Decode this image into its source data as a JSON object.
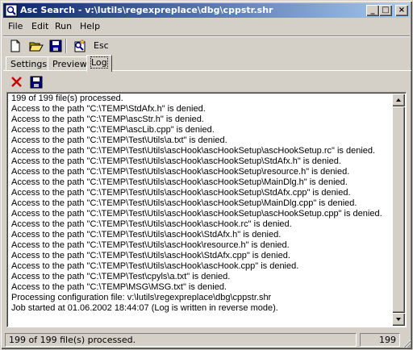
{
  "window": {
    "title": "Asc Search - v:\\lutils\\regexpreplace\\dbg\\cppstr.shr"
  },
  "title_buttons": {
    "minimize": "_",
    "maximize": "□",
    "close": "×"
  },
  "menu": [
    {
      "label": "File"
    },
    {
      "label": "Edit"
    },
    {
      "label": "Run"
    },
    {
      "label": "Help"
    }
  ],
  "toolbar": {
    "icons": [
      "new-file-icon",
      "open-folder-icon",
      "save-icon",
      "search-run-icon"
    ],
    "esc_label": "Esc"
  },
  "tabs": [
    {
      "label": "Settings"
    },
    {
      "label": "Preview"
    },
    {
      "label": "Log",
      "active": true
    }
  ],
  "log_toolbar": {
    "icons": [
      "clear-log-icon",
      "save-log-icon"
    ],
    "clear_color": "#cc0000"
  },
  "log": {
    "lines": [
      "199 of 199 file(s) processed.",
      "Access to the path \"C:\\TEMP\\StdAfx.h\" is denied.",
      "Access to the path \"C:\\TEMP\\ascStr.h\" is denied.",
      "Access to the path \"C:\\TEMP\\ascLib.cpp\" is denied.",
      "Access to the path \"C:\\TEMP\\Test\\Utils\\a.txt\" is denied.",
      "Access to the path \"C:\\TEMP\\Test\\Utils\\ascHook\\ascHookSetup\\ascHookSetup.rc\" is denied.",
      "Access to the path \"C:\\TEMP\\Test\\Utils\\ascHook\\ascHookSetup\\StdAfx.h\" is denied.",
      "Access to the path \"C:\\TEMP\\Test\\Utils\\ascHook\\ascHookSetup\\resource.h\" is denied.",
      "Access to the path \"C:\\TEMP\\Test\\Utils\\ascHook\\ascHookSetup\\MainDlg.h\" is denied.",
      "Access to the path \"C:\\TEMP\\Test\\Utils\\ascHook\\ascHookSetup\\StdAfx.cpp\" is denied.",
      "Access to the path \"C:\\TEMP\\Test\\Utils\\ascHook\\ascHookSetup\\MainDlg.cpp\" is denied.",
      "Access to the path \"C:\\TEMP\\Test\\Utils\\ascHook\\ascHookSetup\\ascHookSetup.cpp\" is denied.",
      "Access to the path \"C:\\TEMP\\Test\\Utils\\ascHook\\ascHook.rc\" is denied.",
      "Access to the path \"C:\\TEMP\\Test\\Utils\\ascHook\\StdAfx.h\" is denied.",
      "Access to the path \"C:\\TEMP\\Test\\Utils\\ascHook\\resource.h\" is denied.",
      "Access to the path \"C:\\TEMP\\Test\\Utils\\ascHook\\StdAfx.cpp\" is denied.",
      "Access to the path \"C:\\TEMP\\Test\\Utils\\ascHook\\ascHook.cpp\" is denied.",
      "Access to the path \"C:\\TEMP\\Test\\cpyls\\a.txt\" is denied.",
      "Access to the path \"C:\\TEMP\\MSG\\MSG.txt\" is denied.",
      "Processing configuration file: v:\\lutils\\regexpreplace\\dbg\\cppstr.shr",
      "Job started at 01.06.2002 18:44:07 (Log is written in reverse mode)."
    ]
  },
  "status": {
    "message": "199 of 199 file(s) processed.",
    "count": "199"
  },
  "colors": {
    "title_start": "#0a246a",
    "title_end": "#a6caf0",
    "face": "#d4d0c8"
  }
}
